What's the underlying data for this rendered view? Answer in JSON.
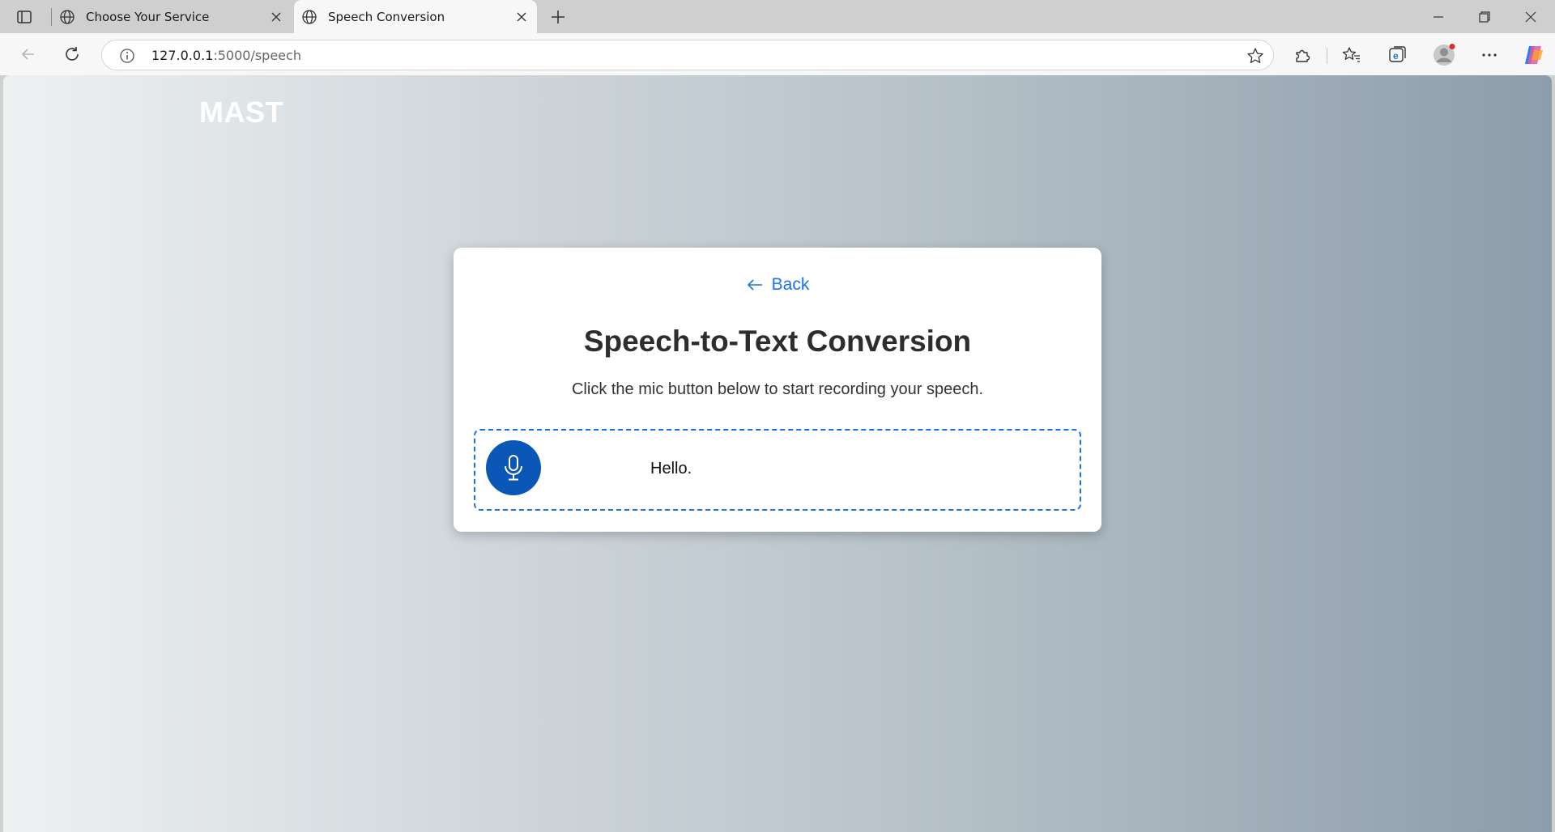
{
  "browser": {
    "tabs": [
      {
        "title": "Choose Your Service",
        "active": false,
        "icon": "globe-icon"
      },
      {
        "title": "Speech Conversion",
        "active": true,
        "icon": "globe-icon"
      }
    ],
    "url": {
      "host": "127.0.0.1",
      "path": ":5000/speech"
    },
    "toolbar_icons": [
      "extensions-icon",
      "favorites-icon",
      "collections-icon",
      "profile-icon",
      "more-icon",
      "copilot-icon"
    ]
  },
  "page": {
    "logo": "MAST",
    "back_label": "Back",
    "title": "Speech-to-Text Conversion",
    "subtitle": "Click the mic button below to start recording your speech.",
    "transcript": "Hello.",
    "mic_icon": "microphone-icon"
  },
  "colors": {
    "accent": "#1a73e8",
    "mic_button": "#0b57b7",
    "gradient_start": "#eef1f2",
    "gradient_end": "#8e9dab"
  }
}
